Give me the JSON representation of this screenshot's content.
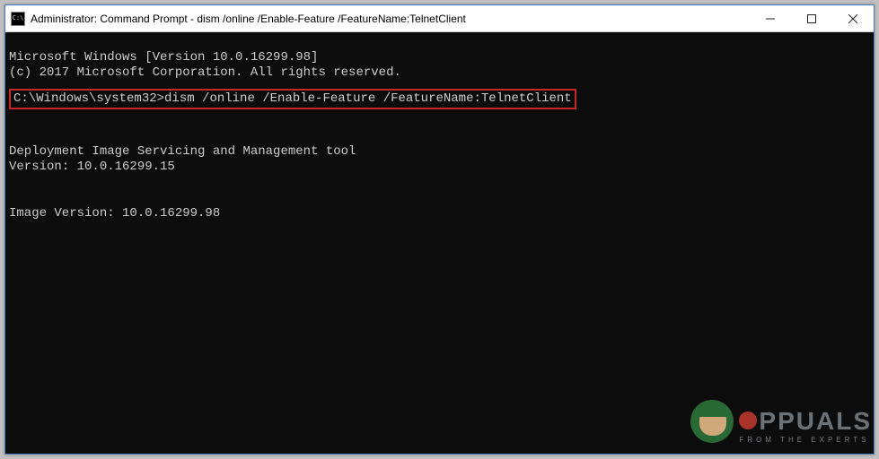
{
  "titlebar": {
    "icon_text": "C:\\",
    "title": "Administrator: Command Prompt - dism  /online /Enable-Feature /FeatureName:TelnetClient"
  },
  "terminal": {
    "line1": "Microsoft Windows [Version 10.0.16299.98]",
    "line2": "(c) 2017 Microsoft Corporation. All rights reserved.",
    "prompt_path": "C:\\Windows\\system32>",
    "command": "dism /online /Enable-Feature /FeatureName:TelnetClient",
    "out1": "Deployment Image Servicing and Management tool",
    "out2": "Version: 10.0.16299.15",
    "out3": "Image Version: 10.0.16299.98"
  },
  "watermark": {
    "brand": "PPUALS",
    "tagline": "FROM THE EXPERTS"
  }
}
